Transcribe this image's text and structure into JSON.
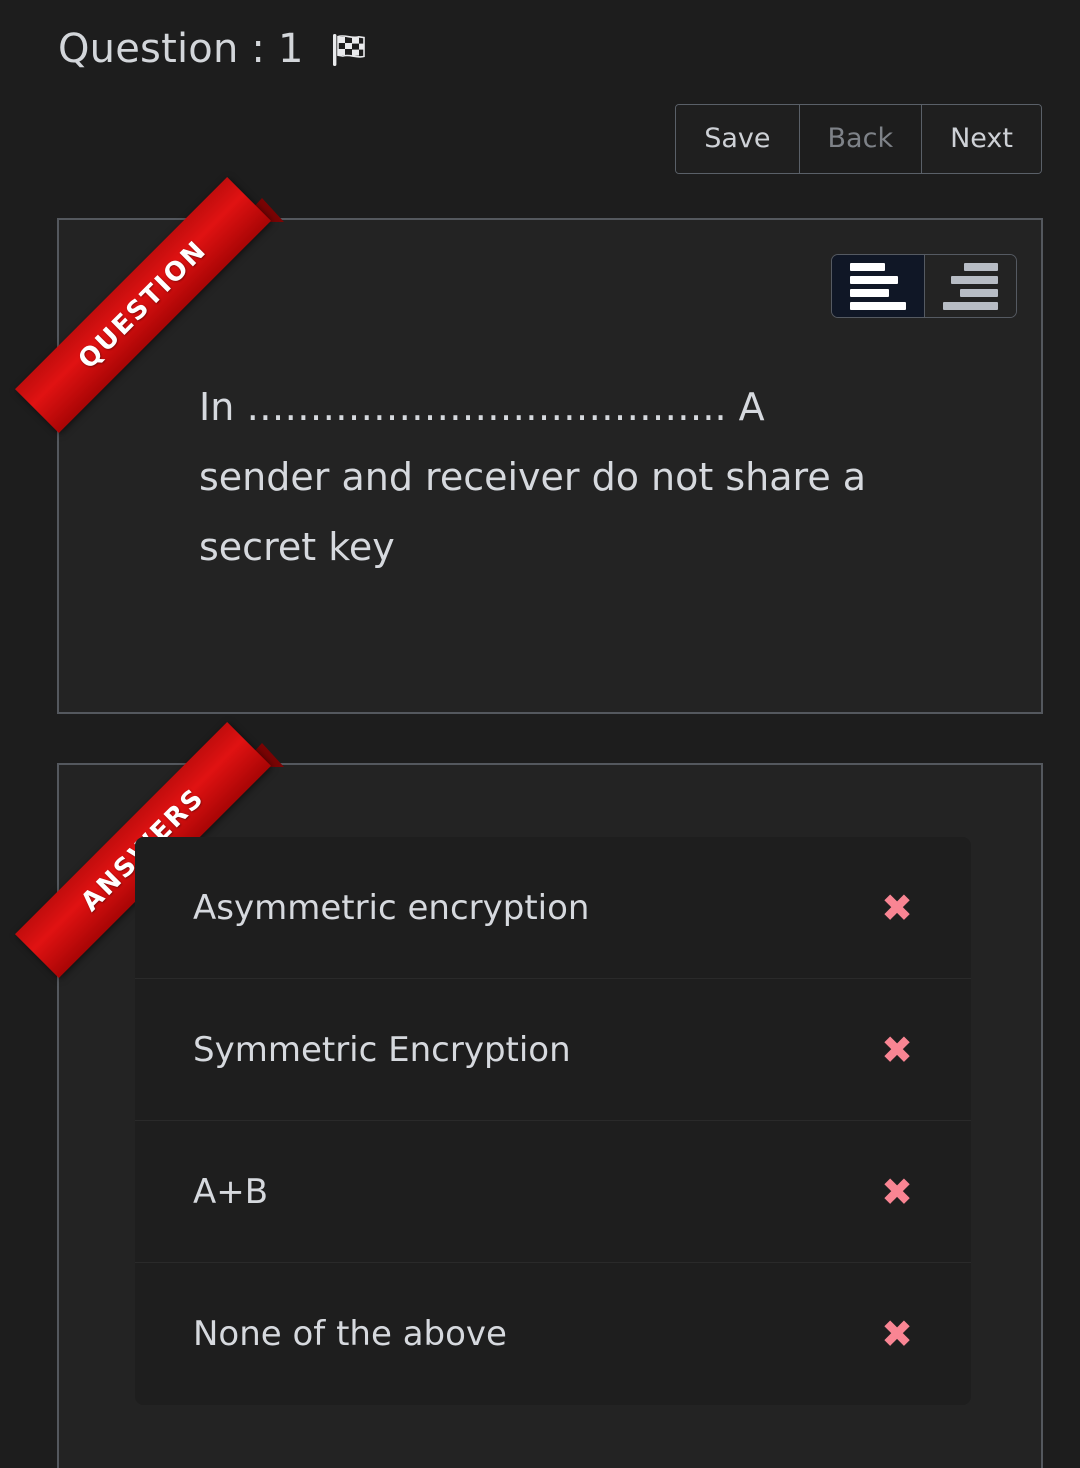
{
  "header": {
    "title": "Question : 1",
    "flag_icon": "checkered-flag-icon",
    "buttons": [
      {
        "label": "Save",
        "state": "enabled"
      },
      {
        "label": "Back",
        "state": "disabled"
      },
      {
        "label": "Next",
        "state": "enabled"
      }
    ]
  },
  "question_panel": {
    "ribbon_label": "QUESTION",
    "ribbon_color": "#e01212",
    "align_controls": [
      {
        "name": "align-left",
        "active": true
      },
      {
        "name": "align-right",
        "active": false
      }
    ],
    "text": "In ……………………………….. A sender and receiver do not share a secret key"
  },
  "answers_panel": {
    "ribbon_label": "ANSWERS",
    "ribbon_color": "#e01212",
    "mark_color": "#f98593",
    "mark_glyph": "✖",
    "options": [
      {
        "label": "Asymmetric encryption",
        "mark": "✖"
      },
      {
        "label": "Symmetric Encryption",
        "mark": "✖"
      },
      {
        "label": "A+B",
        "mark": "✖"
      },
      {
        "label": "None of the above",
        "mark": "✖"
      }
    ]
  }
}
